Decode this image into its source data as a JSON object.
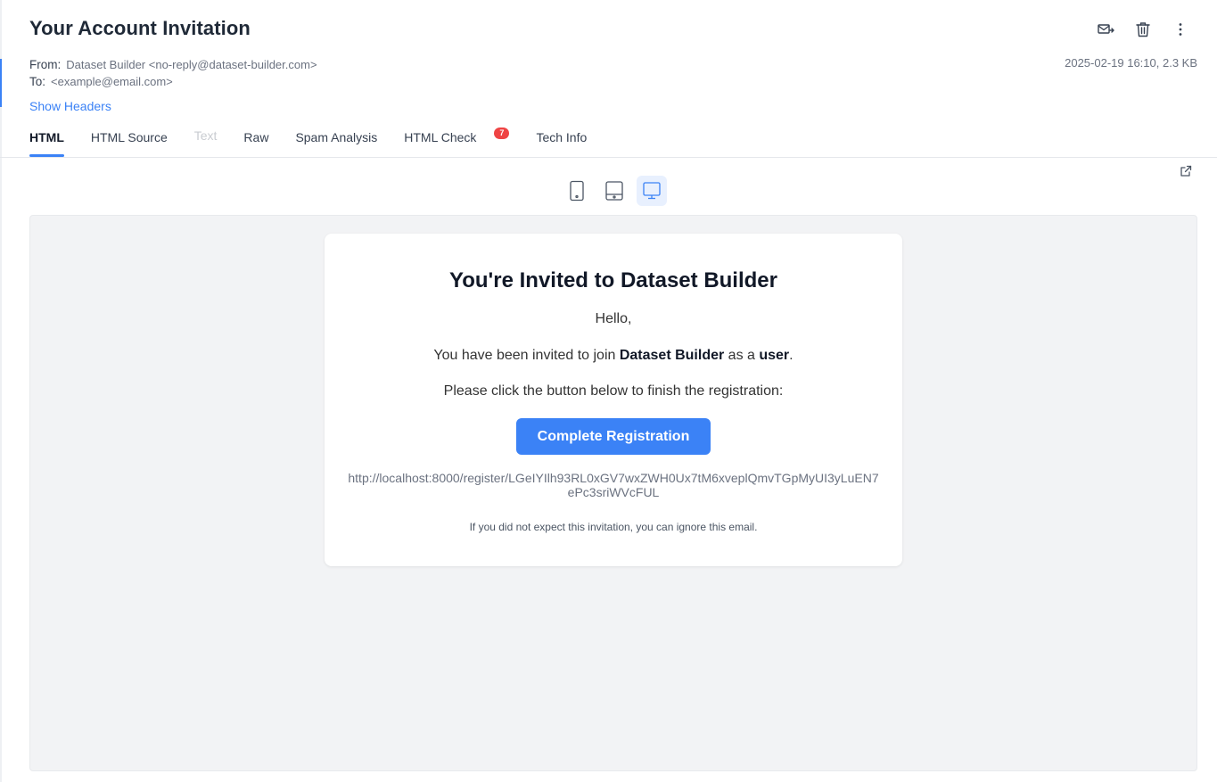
{
  "email": {
    "subject": "Your Account Invitation",
    "from_label": "From:",
    "from_value": "Dataset Builder <no-reply@dataset-builder.com>",
    "to_label": "To:",
    "to_value": "<example@email.com>",
    "date_size": "2025-02-19 16:10, 2.3 KB",
    "show_headers": "Show Headers"
  },
  "actions": [
    {
      "icon": "forward-mail-icon"
    },
    {
      "icon": "trash-icon"
    },
    {
      "icon": "more-vertical-icon"
    }
  ],
  "tabs": [
    {
      "label": "HTML",
      "active": true
    },
    {
      "label": "HTML Source"
    },
    {
      "label": "Text",
      "disabled": true
    },
    {
      "label": "Raw"
    },
    {
      "label": "Spam Analysis"
    },
    {
      "label": "HTML Check",
      "badge": "7"
    },
    {
      "label": "Tech Info"
    }
  ],
  "devices": {
    "selected": "desktop",
    "items": [
      "mobile",
      "tablet",
      "desktop"
    ]
  },
  "preview": {
    "heading": "You're Invited to Dataset Builder",
    "greeting": "Hello,",
    "invite_prefix": "You have been invited to join ",
    "invite_app": "Dataset Builder",
    "invite_mid": " as a ",
    "invite_role": "user",
    "invite_suffix": ".",
    "instruction": "Please click the button below to finish the registration:",
    "button_label": "Complete Registration",
    "link": "http://localhost:8000/register/LGeIYIlh93RL0xGV7wxZWH0Ux7tM6xveplQmvTGpMyUI3yLuEN7ePc3sriWVcFUL",
    "footnote": "If you did not expect this invitation, you can ignore this email."
  },
  "colors": {
    "accent": "#3b82f6",
    "badge": "#ef4444",
    "preview_bg": "#f2f3f5"
  }
}
